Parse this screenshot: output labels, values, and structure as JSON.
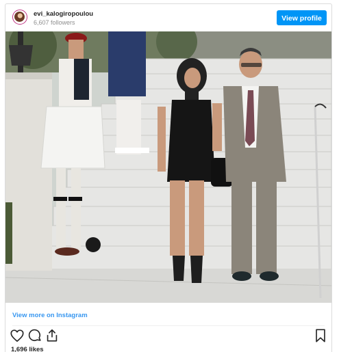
{
  "header": {
    "username": "evi_kalogiropoulou",
    "followers": "6,607 followers",
    "view_profile_label": "View profile"
  },
  "post": {
    "view_more_label": "View more on Instagram",
    "likes": "1,696 likes"
  },
  "colors": {
    "accent": "#0095f6",
    "link": "#3897f0",
    "border": "#dbdbdb",
    "text": "#262626",
    "muted": "#8e8e8e"
  },
  "icons": {
    "avatar": "avatar",
    "like": "heart-icon",
    "comment": "comment-icon",
    "share": "share-icon",
    "save": "bookmark-icon"
  }
}
